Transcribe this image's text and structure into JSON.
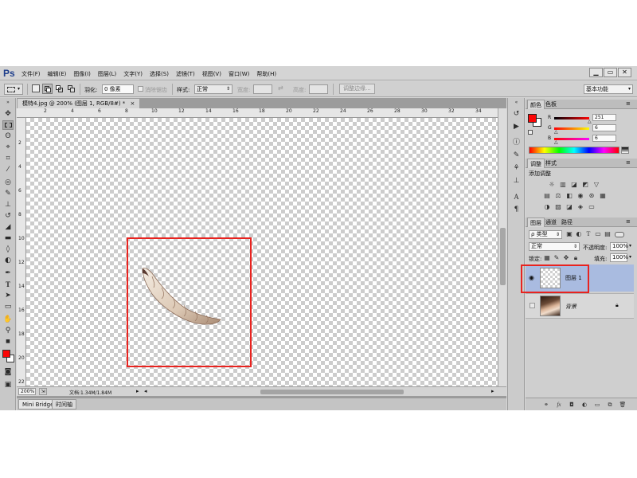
{
  "app": {
    "logo": "Ps"
  },
  "menubar": {
    "items": [
      "文件(F)",
      "编辑(E)",
      "图像(I)",
      "图层(L)",
      "文字(Y)",
      "选择(S)",
      "滤镜(T)",
      "视图(V)",
      "窗口(W)",
      "帮助(H)"
    ],
    "window_buttons": [
      "▁",
      "▭",
      "✕"
    ]
  },
  "options": {
    "feather_label": "羽化:",
    "feather_value": "0 像素",
    "antialias_label": "消除锯齿",
    "style_label": "样式:",
    "style_value": "正常",
    "width_label": "宽度:",
    "height_label": "高度:",
    "refine_edge": "调整边缘...",
    "workspace": "基本功能"
  },
  "document": {
    "tab_title": "模特4.jpg @ 200% (图层 1, RGB/8#) *",
    "ruler_h": [
      "2",
      "4",
      "6",
      "8",
      "10",
      "12",
      "14",
      "16",
      "18",
      "20",
      "22",
      "24",
      "26",
      "28",
      "30",
      "32",
      "34"
    ],
    "ruler_v": [
      "2",
      "4",
      "6",
      "8",
      "10",
      "12",
      "14",
      "16",
      "18",
      "20",
      "22"
    ],
    "zoom": "200%",
    "doc_info": "文档:1.34M/1.84M"
  },
  "bottom_tabs": [
    "Mini Bridge",
    "时间轴"
  ],
  "color_panel": {
    "tabs": [
      "颜色",
      "色板"
    ],
    "labels": {
      "r": "R",
      "g": "G",
      "b": "B"
    },
    "values": {
      "r": "251",
      "g": "6",
      "b": "6"
    },
    "fg_color": "#fb0606",
    "bg_color": "#ffffff"
  },
  "adjustments_panel": {
    "tabs": [
      "调整",
      "样式"
    ],
    "title": "添加调整"
  },
  "layers_panel": {
    "tabs": [
      "图层",
      "通道",
      "路径"
    ],
    "filter_kind": "ρ 类型",
    "blend_mode": "正常",
    "opacity_label": "不透明度:",
    "opacity_value": "100%",
    "lock_label": "锁定:",
    "fill_label": "填充:",
    "fill_value": "100%",
    "layers": [
      {
        "name": "图层 1",
        "selected": true
      },
      {
        "name": "背景",
        "selected": false
      }
    ]
  },
  "colors": {
    "highlight_box": "#e8231f",
    "selected_layer": "#a9bbe0"
  }
}
